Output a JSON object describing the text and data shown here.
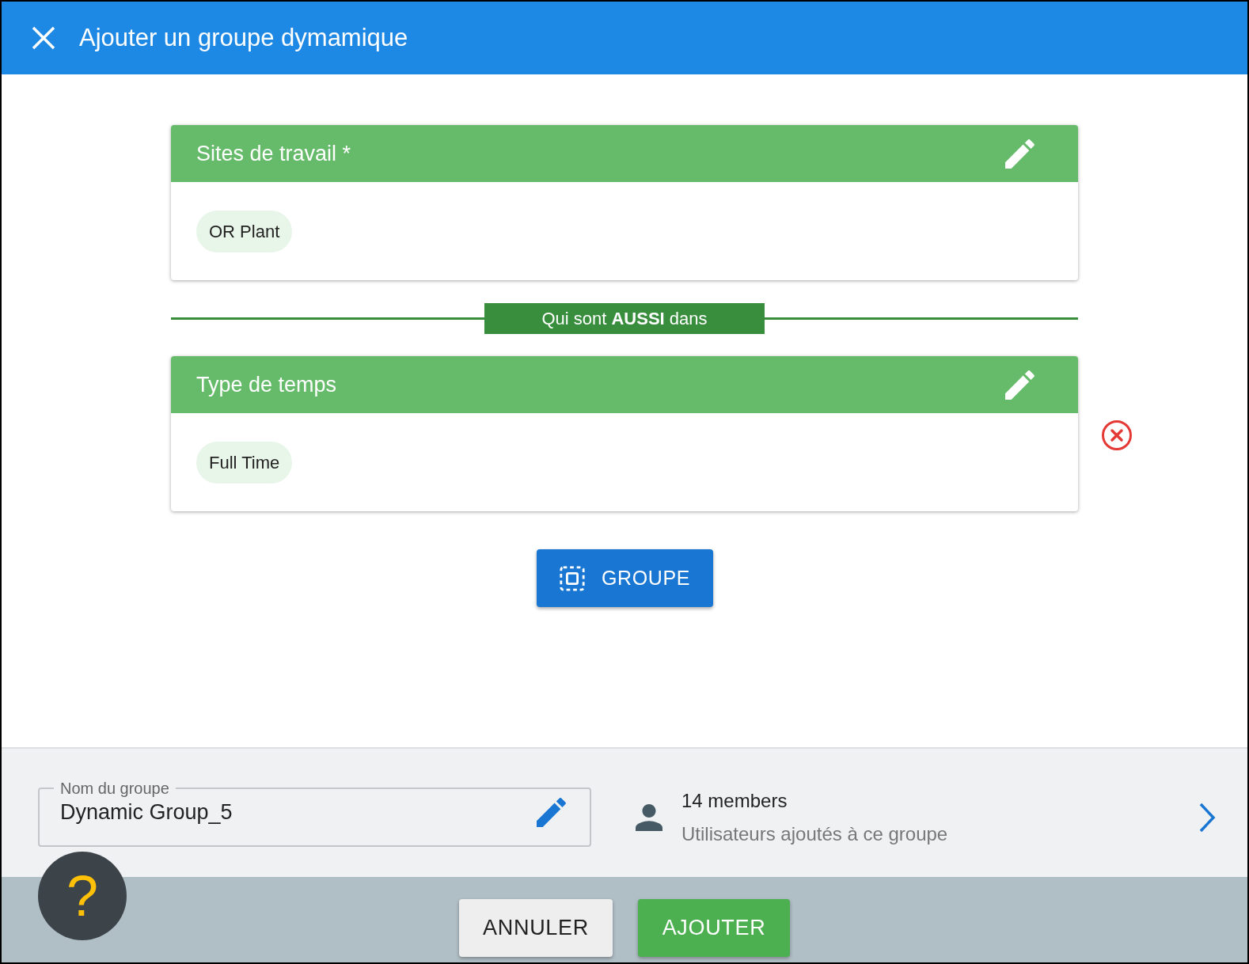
{
  "header": {
    "title": "Ajouter un groupe dymamique"
  },
  "criteria": [
    {
      "title": "Sites de travail *",
      "chips": [
        "OR Plant"
      ],
      "kind": "fixed"
    },
    {
      "title": "Type de temps",
      "chips": [
        "Full Time"
      ],
      "kind": "removable"
    }
  ],
  "connector": "Qui sont **AUSSI** dans",
  "group_button": "GROUPE",
  "name_field": {
    "label": "Nom du groupe",
    "value": "Dynamic Group_5"
  },
  "members": {
    "count": "14 members",
    "description": "Utilisateurs ajoutés à ce groupe"
  },
  "buttons": {
    "cancel": "ANNULER",
    "add": "AJOUTER"
  },
  "help": "?"
}
